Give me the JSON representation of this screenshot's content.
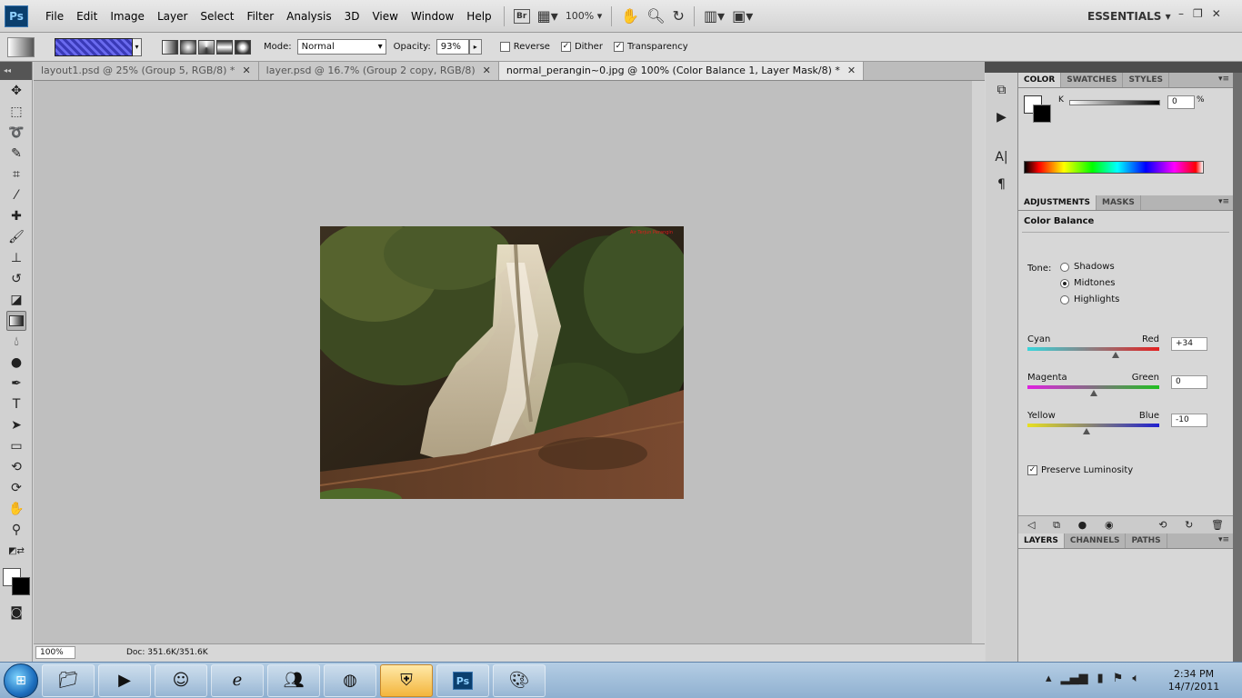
{
  "app": {
    "logo": "Ps",
    "menu": [
      "File",
      "Edit",
      "Image",
      "Layer",
      "Select",
      "Filter",
      "Analysis",
      "3D",
      "View",
      "Window",
      "Help"
    ],
    "bridge_label": "Br",
    "zoom": "100%",
    "workspace": "ESSENTIALS",
    "window_controls": [
      "–",
      "❐",
      "✕"
    ]
  },
  "options": {
    "mode_label": "Mode:",
    "mode_value": "Normal",
    "opacity_label": "Opacity:",
    "opacity_value": "93%",
    "reverse_label": "Reverse",
    "reverse_checked": false,
    "dither_label": "Dither",
    "dither_checked": true,
    "transparency_label": "Transparency",
    "transparency_checked": true
  },
  "tabs": [
    {
      "label": "layout1.psd @ 25% (Group 5, RGB/8) *",
      "active": false
    },
    {
      "label": "layer.psd @ 16.7% (Group 2 copy, RGB/8)",
      "active": false
    },
    {
      "label": "normal_perangin~0.jpg @ 100% (Color Balance 1, Layer Mask/8) *",
      "active": true
    }
  ],
  "tab_close": "✕",
  "photo": {
    "watermark": "Air Terjun Perangin"
  },
  "status": {
    "zoom": "100%",
    "doc": "Doc: 351.6K/351.6K"
  },
  "color_panel": {
    "tabs": [
      "COLOR",
      "SWATCHES",
      "STYLES"
    ],
    "channel": "K",
    "value": "0",
    "unit": "%"
  },
  "adjustments": {
    "tabs": [
      "ADJUSTMENTS",
      "MASKS"
    ],
    "title": "Color Balance",
    "tone_label": "Tone:",
    "tones": [
      {
        "label": "Shadows",
        "selected": false
      },
      {
        "label": "Midtones",
        "selected": true
      },
      {
        "label": "Highlights",
        "selected": false
      }
    ],
    "sliders": [
      {
        "left": "Cyan",
        "right": "Red",
        "value": "+34",
        "level": 0.67,
        "color_a": "#38d6dc",
        "color_b": "#e42020"
      },
      {
        "left": "Magenta",
        "right": "Green",
        "value": "0",
        "level": 0.5,
        "color_a": "#e020e0",
        "color_b": "#20c020"
      },
      {
        "left": "Yellow",
        "right": "Blue",
        "value": "-10",
        "level": 0.45,
        "color_a": "#e8e020",
        "color_b": "#2020d0"
      }
    ],
    "preserve_luminosity_label": "Preserve Luminosity",
    "preserve_luminosity_checked": true
  },
  "layers_panel": {
    "tabs": [
      "LAYERS",
      "CHANNELS",
      "PATHS"
    ]
  },
  "taskbar": {
    "time": "2:34 PM",
    "date": "14/7/2011"
  }
}
